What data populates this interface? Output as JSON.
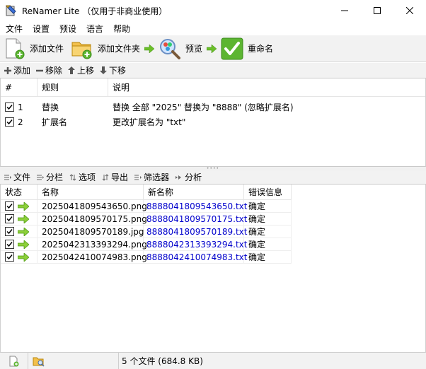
{
  "window": {
    "title": "ReNamer Lite （仅用于非商业使用）"
  },
  "menu": [
    "文件",
    "设置",
    "预设",
    "语言",
    "帮助"
  ],
  "toolbar": {
    "add_files": "添加文件",
    "add_folder": "添加文件夹",
    "preview": "预览",
    "rename": "重命名"
  },
  "rules_toolbar": {
    "add": "添加",
    "remove": "移除",
    "up": "上移",
    "down": "下移"
  },
  "rules_table": {
    "headers": {
      "num": "#",
      "rule": "规则",
      "desc": "说明"
    },
    "rows": [
      {
        "num": "1",
        "rule": "替换",
        "desc": "替换 全部 \"2025\" 替换为 \"8888\" (忽略扩展名)",
        "checked": true
      },
      {
        "num": "2",
        "rule": "扩展名",
        "desc": "更改扩展名为 \"txt\"",
        "checked": true
      }
    ]
  },
  "files_toolbar": {
    "files": "文件",
    "columns": "分栏",
    "options": "选项",
    "export": "导出",
    "filter": "筛选器",
    "analyze": "分析"
  },
  "files_table": {
    "headers": {
      "state": "状态",
      "name": "名称",
      "new_name": "新名称",
      "error": "错误信息"
    },
    "rows": [
      {
        "name": "2025041809543650.png",
        "new_name": "8888041809543650.txt",
        "error": "确定",
        "checked": true
      },
      {
        "name": "2025041809570175.png",
        "new_name": "8888041809570175.txt",
        "error": "确定",
        "checked": true
      },
      {
        "name": "2025041809570189.jpg",
        "new_name": "8888041809570189.txt",
        "error": "确定",
        "checked": true
      },
      {
        "name": "2025042313393294.png",
        "new_name": "8888042313393294.txt",
        "error": "确定",
        "checked": true
      },
      {
        "name": "2025042410074983.png",
        "new_name": "8888042410074983.txt",
        "error": "确定",
        "checked": true
      }
    ]
  },
  "status": {
    "summary": "5 个文件 (684.8 KB)"
  },
  "colors": {
    "accent_green": "#5cb531",
    "new_name_blue": "#0000cc",
    "arrow_green": "#6bbf2a"
  }
}
